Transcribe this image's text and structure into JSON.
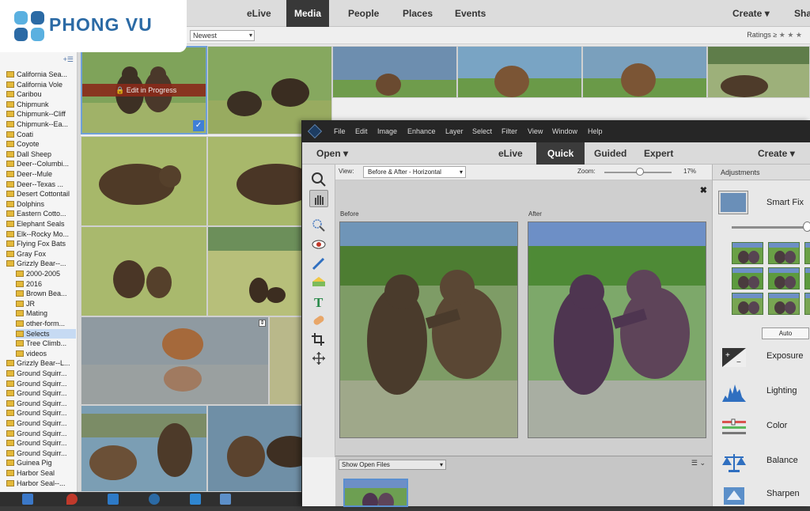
{
  "brand": {
    "name": "PHONG VU"
  },
  "organizer": {
    "tabs": [
      {
        "label": "eLive",
        "active": false
      },
      {
        "label": "Media",
        "active": true
      },
      {
        "label": "People",
        "active": false
      },
      {
        "label": "Places",
        "active": false
      },
      {
        "label": "Events",
        "active": false
      }
    ],
    "create_label": "Create",
    "share_label": "Sha",
    "sort": {
      "value": "Newest"
    },
    "ratings": {
      "label": "Ratings",
      "op": "≥",
      "stars": "★ ★ ★"
    },
    "edit_badge": "Edit in Progress",
    "folders": [
      {
        "name": "California Sea...",
        "sub": false
      },
      {
        "name": "California Vole",
        "sub": false
      },
      {
        "name": "Caribou",
        "sub": false
      },
      {
        "name": "Chipmunk",
        "sub": false
      },
      {
        "name": "Chipmunk--Cliff",
        "sub": false
      },
      {
        "name": "Chipmunk--Ea...",
        "sub": false
      },
      {
        "name": "Coati",
        "sub": false
      },
      {
        "name": "Coyote",
        "sub": false
      },
      {
        "name": "Dall Sheep",
        "sub": false
      },
      {
        "name": "Deer--Columbi...",
        "sub": false
      },
      {
        "name": "Deer--Mule",
        "sub": false
      },
      {
        "name": "Deer--Texas ...",
        "sub": false
      },
      {
        "name": "Desert Cottontail",
        "sub": false
      },
      {
        "name": "Dolphins",
        "sub": false
      },
      {
        "name": "Eastern Cotto...",
        "sub": false
      },
      {
        "name": "Elephant Seals",
        "sub": false
      },
      {
        "name": "Elk--Rocky Mo...",
        "sub": false
      },
      {
        "name": "Flying Fox Bats",
        "sub": false
      },
      {
        "name": "Gray Fox",
        "sub": false
      },
      {
        "name": "Grizzly Bear--...",
        "sub": false
      },
      {
        "name": "2000-2005",
        "sub": true
      },
      {
        "name": "2016",
        "sub": true
      },
      {
        "name": "Brown Bea...",
        "sub": true
      },
      {
        "name": "JR",
        "sub": true
      },
      {
        "name": "Mating",
        "sub": true
      },
      {
        "name": "other-form...",
        "sub": true
      },
      {
        "name": "Selects",
        "sub": true,
        "selected": true
      },
      {
        "name": "Tree Climb...",
        "sub": true
      },
      {
        "name": "videos",
        "sub": true
      },
      {
        "name": "Grizzly Bear--L...",
        "sub": false
      },
      {
        "name": "Ground Squirr...",
        "sub": false
      },
      {
        "name": "Ground Squirr...",
        "sub": false
      },
      {
        "name": "Ground Squirr...",
        "sub": false
      },
      {
        "name": "Ground Squirr...",
        "sub": false
      },
      {
        "name": "Ground Squirr...",
        "sub": false
      },
      {
        "name": "Ground Squirr...",
        "sub": false
      },
      {
        "name": "Ground Squirr...",
        "sub": false
      },
      {
        "name": "Ground Squirr...",
        "sub": false
      },
      {
        "name": "Ground Squirr...",
        "sub": false
      },
      {
        "name": "Guinea Pig",
        "sub": false
      },
      {
        "name": "Harbor Seal",
        "sub": false
      },
      {
        "name": "Harbor Seal--...",
        "sub": false
      }
    ]
  },
  "editor": {
    "menu": [
      "File",
      "Edit",
      "Image",
      "Enhance",
      "Layer",
      "Select",
      "Filter",
      "View",
      "Window",
      "Help"
    ],
    "open_label": "Open",
    "modes": [
      {
        "label": "eLive",
        "active": false
      },
      {
        "label": "Quick",
        "active": true
      },
      {
        "label": "Guided",
        "active": false
      },
      {
        "label": "Expert",
        "active": false
      }
    ],
    "create_label": "Create",
    "view_label": "View:",
    "view_value": "Before & After - Horizontal",
    "zoom_label": "Zoom:",
    "zoom_value": "17%",
    "before_label": "Before",
    "after_label": "After",
    "close_glyph": "✖",
    "bin_select": "Show Open Files",
    "bin_controls": "☰ ⌄",
    "panel": {
      "title": "Adjustments",
      "smart_fix": "Smart Fix",
      "smart_fix_level": 0.95,
      "auto": "Auto",
      "items": [
        "Exposure",
        "Lighting",
        "Color",
        "Balance",
        "Sharpen"
      ]
    }
  },
  "colors": {
    "accent": "#2b6aa5",
    "selection": "#c6daf3",
    "dark": "#262626"
  }
}
